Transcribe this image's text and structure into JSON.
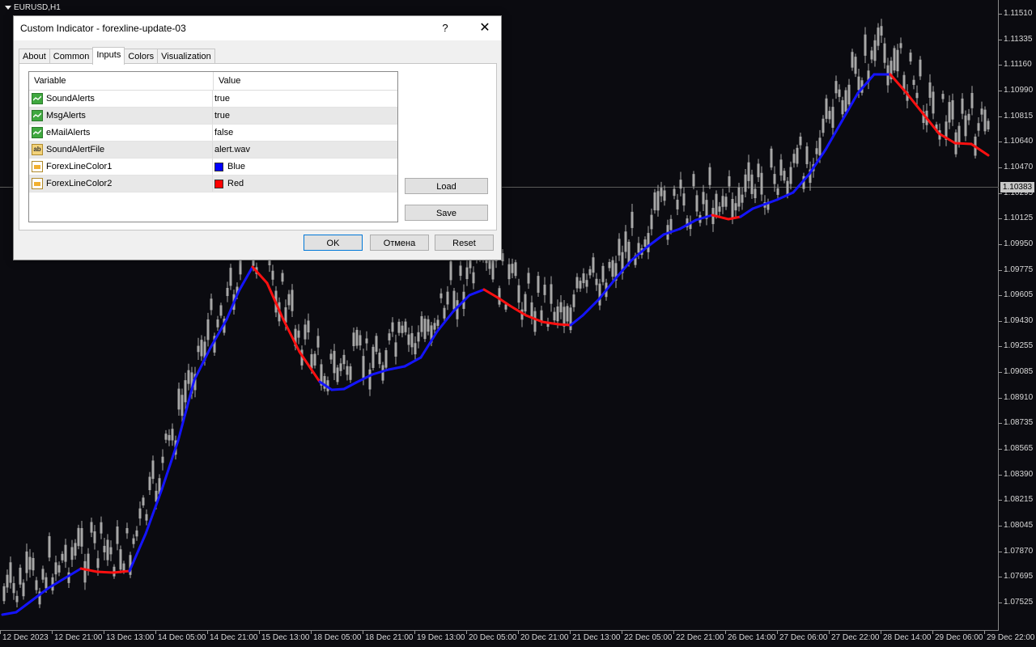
{
  "chart": {
    "symbol": "EURUSD,H1",
    "current_price": "1.10383",
    "price_ticks": [
      "1.11510",
      "1.11335",
      "1.11160",
      "1.10990",
      "1.10815",
      "1.10640",
      "1.10470",
      "1.10295",
      "1.10125",
      "1.09950",
      "1.09775",
      "1.09605",
      "1.09430",
      "1.09255",
      "1.09085",
      "1.08910",
      "1.08735",
      "1.08565",
      "1.08390",
      "1.08215",
      "1.08045",
      "1.07870",
      "1.07695",
      "1.07525"
    ],
    "time_ticks": [
      "12 Dec 2023",
      "12 Dec 21:00",
      "13 Dec 13:00",
      "14 Dec 05:00",
      "14 Dec 21:00",
      "15 Dec 13:00",
      "18 Dec 05:00",
      "18 Dec 21:00",
      "19 Dec 13:00",
      "20 Dec 05:00",
      "20 Dec 21:00",
      "21 Dec 13:00",
      "22 Dec 05:00",
      "22 Dec 21:00",
      "26 Dec 14:00",
      "27 Dec 06:00",
      "27 Dec 22:00",
      "28 Dec 14:00",
      "29 Dec 06:00",
      "29 Dec 22:00"
    ],
    "colors": {
      "background": "#0b0b10",
      "candles": "#a8a8a8",
      "up_line": "#1414ff",
      "down_line": "#ff1010"
    }
  },
  "dialog": {
    "title": "Custom Indicator - forexline-update-03",
    "help": "?",
    "close": "✕",
    "tabs": [
      "About",
      "Common",
      "Inputs",
      "Colors",
      "Visualization"
    ],
    "active_tab": "Inputs",
    "grid": {
      "headers": {
        "variable": "Variable",
        "value": "Value"
      },
      "rows": [
        {
          "icon": "bool-icon",
          "variable": "SoundAlerts",
          "value": "true"
        },
        {
          "icon": "bool-icon",
          "variable": "MsgAlerts",
          "value": "true"
        },
        {
          "icon": "bool-icon",
          "variable": "eMailAlerts",
          "value": "false"
        },
        {
          "icon": "string-icon",
          "icon_text": "ab",
          "variable": "SoundAlertFile",
          "value": "alert.wav"
        },
        {
          "icon": "color-icon",
          "variable": "ForexLineColor1",
          "value": "Blue",
          "swatch": "#0000ff"
        },
        {
          "icon": "color-icon",
          "variable": "ForexLineColor2",
          "value": "Red",
          "swatch": "#ff0000"
        }
      ]
    },
    "buttons": {
      "load": "Load",
      "save": "Save",
      "ok": "OK",
      "cancel": "Отмена",
      "reset": "Reset"
    }
  }
}
